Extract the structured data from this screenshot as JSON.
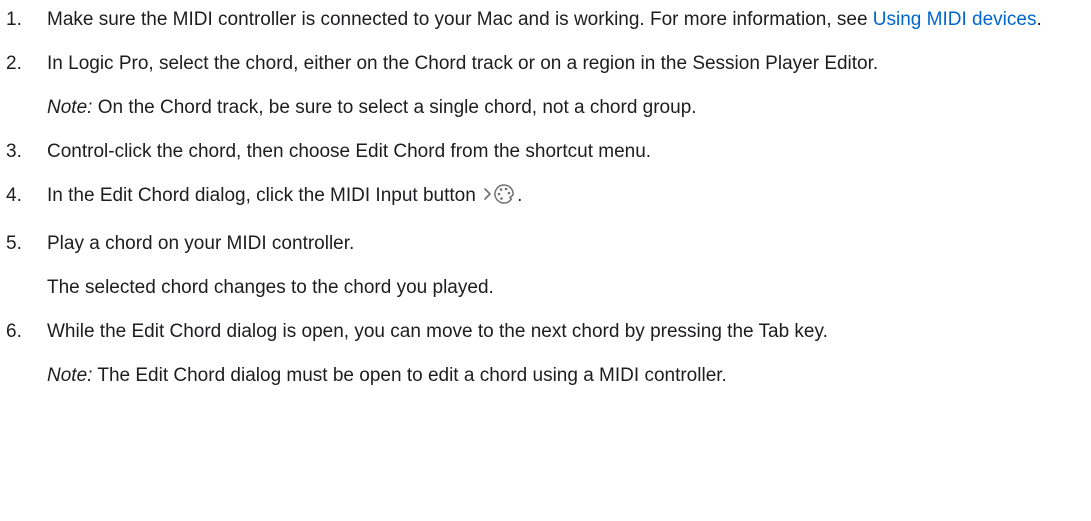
{
  "steps": [
    {
      "number": "1.",
      "text_before": "Make sure the MIDI controller is connected to your Mac and is working. For more information, see ",
      "link": "Using MIDI devices",
      "text_after": "."
    },
    {
      "number": "2.",
      "text": "In Logic Pro, select the chord, either on the Chord track or on a region in the Session Player Editor.",
      "note_label": "Note:",
      "note_text": " On the Chord track, be sure to select a single chord, not a chord group."
    },
    {
      "number": "3.",
      "text": "Control-click the chord, then choose Edit Chord from the shortcut menu."
    },
    {
      "number": "4.",
      "text_before": "In the Edit Chord dialog, click the MIDI Input button ",
      "icon": "midi-input-icon",
      "text_after": "."
    },
    {
      "number": "5.",
      "text": "Play a chord on your MIDI controller.",
      "result": "The selected chord changes to the chord you played."
    },
    {
      "number": "6.",
      "text": "While the Edit Chord dialog is open, you can move to the next chord by pressing the Tab key.",
      "note_label": "Note:",
      "note_text": " The Edit Chord dialog must be open to edit a chord using a MIDI controller."
    }
  ],
  "colors": {
    "text": "#1d1d1f",
    "link": "#0066cc"
  }
}
